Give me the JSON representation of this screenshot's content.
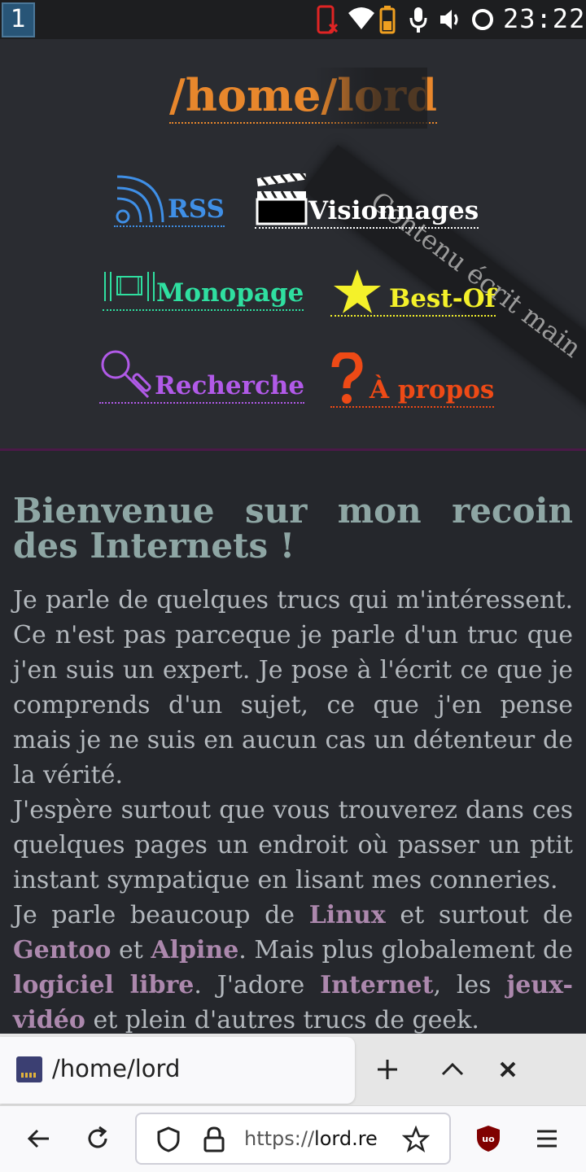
{
  "status_bar": {
    "workspace": "1",
    "time": "23:22",
    "icons": [
      "phone-off-icon",
      "wifi-icon",
      "battery-icon",
      "microphone-icon",
      "volume-icon",
      "circle-icon"
    ]
  },
  "site": {
    "title": "/home/lord",
    "ribbon": "Contenu écrit main",
    "nav": {
      "rss": "RSS",
      "visionnages": "Visionnages",
      "monopage": "Monopage",
      "bestof": "Best-Of",
      "recherche": "Recherche",
      "apropos": "À propos"
    }
  },
  "content": {
    "welcome": "Bienvenue sur mon recoin des Internets !",
    "p1": "Je parle de quelques trucs qui m'intéressent. Ce n'est pas parceque je parle d'un truc que j'en suis un expert. Je pose à l'écrit ce que je comprends d'un sujet, ce que j'en pense mais je ne suis en aucun cas un détenteur de la vérité.",
    "p2": "J'espère surtout que vous trouverez dans ces quelques pages un endroit où passer un ptit instant sympatique en lisant mes conneries.",
    "p3": {
      "t1": "Je parle beaucoup de ",
      "linux": "Linux",
      "t2": " et surtout de ",
      "gentoo": "Gentoo",
      "t3": " et ",
      "alpine": "Alpine",
      "t4": ". Mais plus globalement de ",
      "libre": "logiciel libre",
      "t5": ". J'adore ",
      "internet": "Internet",
      "t6": ", les ",
      "jeux": "jeux-vidéo",
      "t7": " et plein d'autres trucs de geek."
    }
  },
  "browser": {
    "tab_title": "/home/lord",
    "url_scheme": "https://",
    "url_host": "lord.re"
  },
  "colors": {
    "title": "#e8872c",
    "rss": "#3f8fe6",
    "monopage": "#2fdfa0",
    "bestof": "#f4f12a",
    "recherche": "#b15ae8",
    "apropos": "#ee4a16",
    "link": "#ac88ad"
  }
}
